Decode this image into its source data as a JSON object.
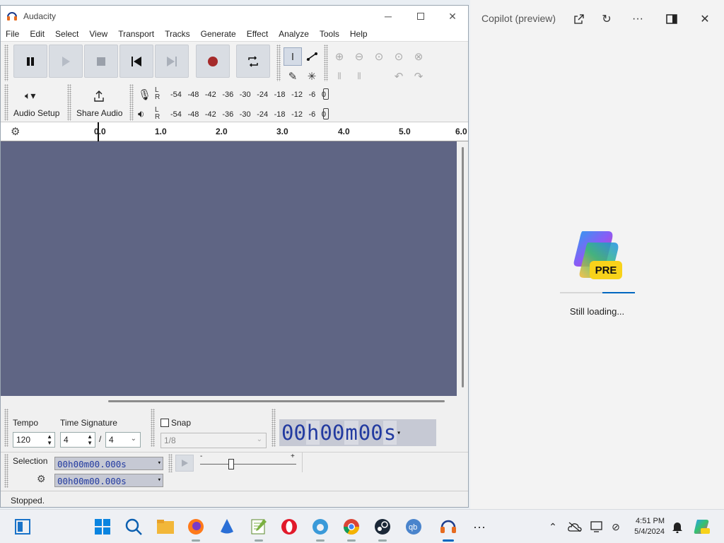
{
  "audacity": {
    "title": "Audacity",
    "menu": [
      "File",
      "Edit",
      "Select",
      "View",
      "Transport",
      "Tracks",
      "Generate",
      "Effect",
      "Analyze",
      "Tools",
      "Help"
    ],
    "audio_setup_label": "Audio Setup",
    "share_audio_label": "Share Audio",
    "meter_scale": [
      "-54",
      "-48",
      "-42",
      "-36",
      "-30",
      "-24",
      "-18",
      "-12",
      "-6",
      "0"
    ],
    "meter_l": "L",
    "meter_r": "R",
    "ruler_labels": [
      "0.0",
      "1.0",
      "2.0",
      "3.0",
      "4.0",
      "5.0",
      "6.0"
    ],
    "tempo_label": "Tempo",
    "tempo_value": "120",
    "time_signature_label": "Time Signature",
    "time_sig_top": "4",
    "time_sig_slash": "/",
    "time_sig_bottom": "4",
    "snap_label": "Snap",
    "snap_value": "1/8",
    "big_time": [
      "00",
      "h",
      "00",
      "m",
      "00",
      "s"
    ],
    "selection_label": "Selection",
    "selection_start": "00h00m00.000s",
    "selection_end": "00h00m00.000s",
    "slider_minus": "-",
    "slider_plus": "+",
    "status": "Stopped."
  },
  "copilot": {
    "title": "Copilot (preview)",
    "badge": "PRE",
    "loading_text": "Still loading..."
  },
  "taskbar": {
    "time": "4:51 PM",
    "date": "5/4/2024"
  },
  "colors": {
    "track_area": "#5f6584",
    "accent": "#0067c0",
    "record": "#a52a2a"
  }
}
